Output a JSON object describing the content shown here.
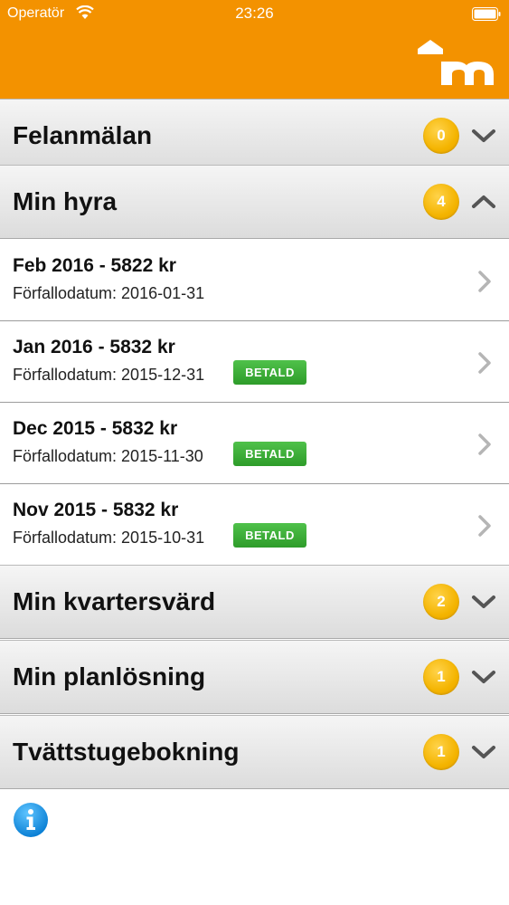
{
  "status_bar": {
    "carrier": "Operatör",
    "time": "23:26"
  },
  "colors": {
    "header": "#f39200",
    "badge": "#f4b400",
    "paid_badge": "#3aa834",
    "info": "#1a8fdc"
  },
  "sections": [
    {
      "title": "Felanmälan",
      "count": "0",
      "expanded": false,
      "icon": "chevron-down-icon"
    },
    {
      "title": "Min hyra",
      "count": "4",
      "expanded": true,
      "icon": "chevron-up-icon"
    },
    {
      "title": "Min kvartersvärd",
      "count": "2",
      "expanded": false,
      "icon": "chevron-down-icon"
    },
    {
      "title": "Min planlösning",
      "count": "1",
      "expanded": false,
      "icon": "chevron-down-icon"
    },
    {
      "title": "Tvättstugebokning",
      "count": "1",
      "expanded": false,
      "icon": "chevron-down-icon"
    }
  ],
  "rent": {
    "items": [
      {
        "title": "Feb 2016 - 5822 kr",
        "due": "Förfallodatum: 2016-01-31",
        "status": ""
      },
      {
        "title": "Jan 2016 - 5832 kr",
        "due": "Förfallodatum: 2015-12-31",
        "status": "BETALD"
      },
      {
        "title": "Dec 2015 - 5832 kr",
        "due": "Förfallodatum: 2015-11-30",
        "status": "BETALD"
      },
      {
        "title": "Nov 2015 - 5832 kr",
        "due": "Förfallodatum: 2015-10-31",
        "status": "BETALD"
      }
    ]
  }
}
